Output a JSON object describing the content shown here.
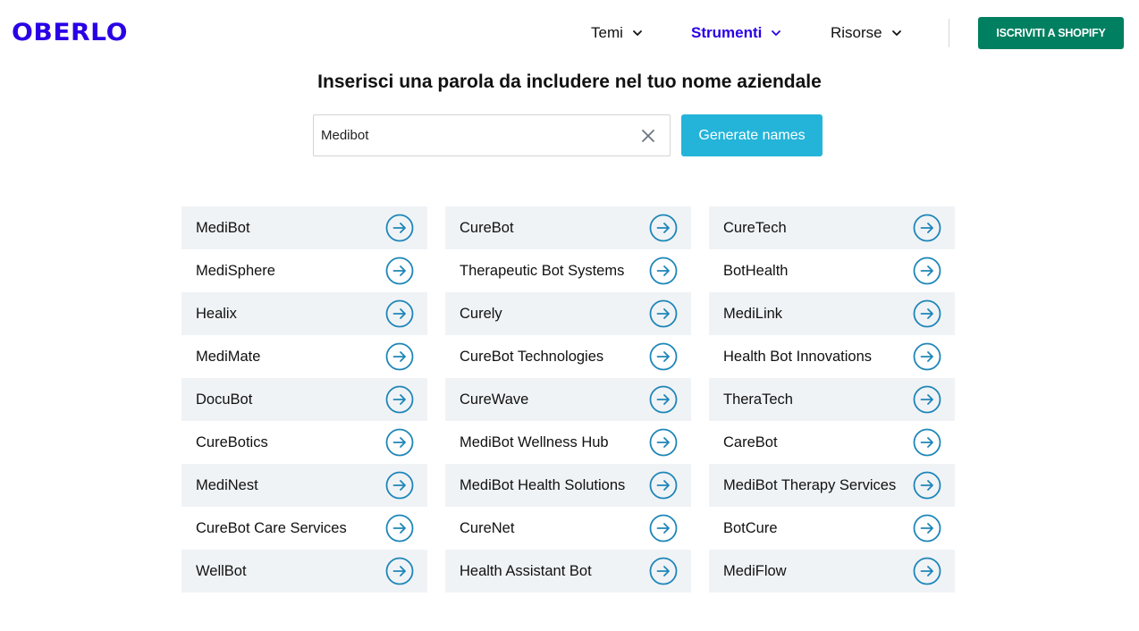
{
  "header": {
    "logo": "OBERLO",
    "nav": [
      {
        "label": "Temi",
        "icon": "chevron-down-icon"
      },
      {
        "label": "Strumenti",
        "icon": "chevron-down-icon"
      },
      {
        "label": "Risorse",
        "icon": "chevron-down-icon"
      }
    ],
    "cta_label": "ISCRIVITI A SHOPIFY"
  },
  "colors": {
    "brand": "#2a00e6",
    "cta": "#008060",
    "generate_button": "#24b4d9",
    "arrow_icon": "#1e86b8",
    "row_alt_bg": "#f0f3f6"
  },
  "main": {
    "title": "Inserisci una parola da includere nel tuo nome aziendale",
    "search": {
      "value": "Medibot",
      "placeholder": ""
    },
    "generate_label": "Generate names"
  },
  "results": {
    "columns": [
      [
        "MediBot",
        "MediSphere",
        "Healix",
        "MediMate",
        "DocuBot",
        "CureBotics",
        "MediNest",
        "CureBot Care Services",
        "WellBot"
      ],
      [
        "CureBot",
        "Therapeutic Bot Systems",
        "Curely",
        "CureBot Technologies",
        "CureWave",
        "MediBot Wellness Hub",
        "MediBot Health Solutions",
        "CureNet",
        "Health Assistant Bot"
      ],
      [
        "CureTech",
        "BotHealth",
        "MediLink",
        "Health Bot Innovations",
        "TheraTech",
        "CareBot",
        "MediBot Therapy Services",
        "BotCure",
        "MediFlow"
      ]
    ]
  }
}
